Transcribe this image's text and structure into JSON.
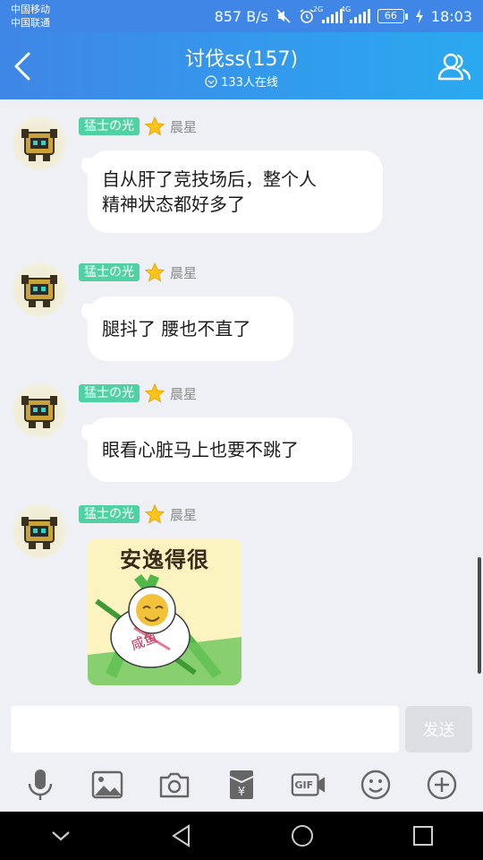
{
  "status": {
    "carrier1": "中国移动",
    "carrier2": "中国联通",
    "speed": "857 B/s",
    "net_tag1": "2G",
    "net_tag2": "4G",
    "battery": "66",
    "time": "18:03"
  },
  "header": {
    "title": "讨伐ss(157)",
    "online": "133人在线"
  },
  "messages": [
    {
      "badge": "猛士の光",
      "rank": "晨星",
      "text_line1": "自从肝了竞技场后，整个人",
      "text_line2": "精神状态都好多了"
    },
    {
      "badge": "猛士の光",
      "rank": "晨星",
      "text": "腿抖了 腰也不直了"
    },
    {
      "badge": "猛士の光",
      "rank": "晨星",
      "text": "眼看心脏马上也要不跳了"
    },
    {
      "badge": "猛士の光",
      "rank": "晨星",
      "sticker_text": "安逸得很",
      "sticker_label": "咸鱼"
    }
  ],
  "composer": {
    "send_label": "发送"
  },
  "toolbar": {
    "gif_label": "GIF"
  },
  "colors": {
    "header_start": "#3f86e6",
    "header_end": "#2aa9f0",
    "badge": "#4fd1a4",
    "background": "#eef0f6"
  }
}
